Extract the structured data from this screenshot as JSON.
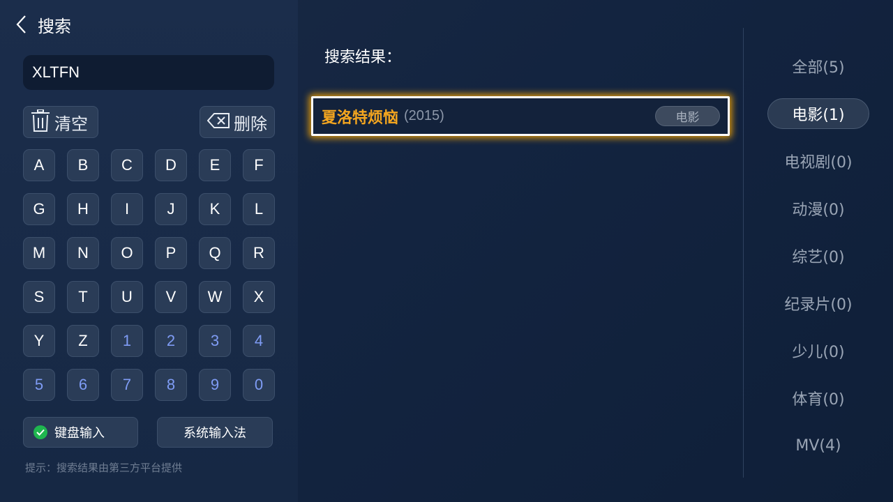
{
  "header": {
    "title": "搜索"
  },
  "search": {
    "value": "XLTFN"
  },
  "actions": {
    "clear_label": "清空",
    "delete_label": "删除"
  },
  "keypad": {
    "rows": [
      [
        "A",
        "B",
        "C",
        "D",
        "E",
        "F"
      ],
      [
        "G",
        "H",
        "I",
        "J",
        "K",
        "L"
      ],
      [
        "M",
        "N",
        "O",
        "P",
        "Q",
        "R"
      ],
      [
        "S",
        "T",
        "U",
        "V",
        "W",
        "X"
      ],
      [
        "Y",
        "Z",
        "1",
        "2",
        "3",
        "4"
      ],
      [
        "5",
        "6",
        "7",
        "8",
        "9",
        "0"
      ]
    ]
  },
  "input_modes": {
    "keyboard_label": "键盘输入",
    "system_label": "系统输入法",
    "selected": "keyboard"
  },
  "hint": "提示：搜索结果由第三方平台提供",
  "results": {
    "title": "搜索结果：",
    "items": [
      {
        "name": "夏洛特烦恼",
        "year": "(2015)",
        "tag": "电影"
      }
    ]
  },
  "categories": [
    {
      "label": "全部(5)",
      "active": false
    },
    {
      "label": "电影(1)",
      "active": true
    },
    {
      "label": "电视剧(0)",
      "active": false
    },
    {
      "label": "动漫(0)",
      "active": false
    },
    {
      "label": "综艺(0)",
      "active": false
    },
    {
      "label": "纪录片(0)",
      "active": false
    },
    {
      "label": "少儿(0)",
      "active": false
    },
    {
      "label": "体育(0)",
      "active": false
    },
    {
      "label": "MV(4)",
      "active": false
    }
  ],
  "colors": {
    "accent": "#f3a51f",
    "digit": "#7f9cf5",
    "check": "#1fb64f"
  },
  "icons": {
    "back": "chevron-left-icon",
    "clear": "trash-icon",
    "delete": "backspace-icon",
    "check": "check-circle-icon"
  }
}
